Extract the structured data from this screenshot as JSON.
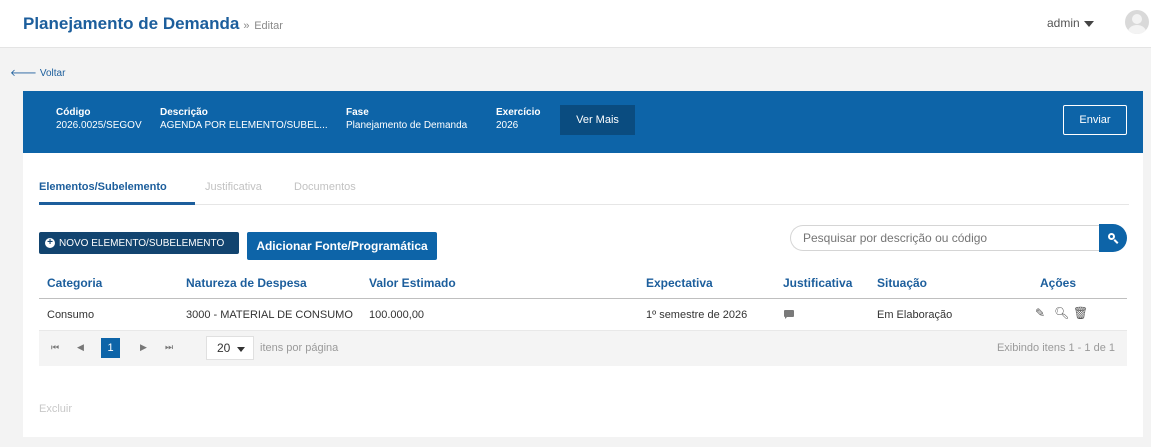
{
  "header": {
    "title": "Planejamento de Demanda",
    "separator": "»",
    "subtitle": "Editar",
    "user": "admin"
  },
  "back_label": "Voltar",
  "info": {
    "codigo_label": "Código",
    "codigo_value": "2026.0025/SEGOV",
    "descricao_label": "Descrição",
    "descricao_value": "AGENDA POR ELEMENTO/SUBEL...",
    "fase_label": "Fase",
    "fase_value": "Planejamento de Demanda",
    "exercicio_label": "Exercício",
    "exercicio_value": "2026",
    "ver_mais": "Ver Mais",
    "enviar": "Enviar"
  },
  "tabs": [
    {
      "label": "Elementos/Subelemento",
      "active": true
    },
    {
      "label": "Justificativa",
      "active": false
    },
    {
      "label": "Documentos",
      "active": false
    }
  ],
  "actions": {
    "novo_label": "NOVO ELEMENTO/SUBELEMENTO",
    "fonte_label": "Adicionar Fonte/Programática",
    "search_placeholder": "Pesquisar por descrição ou código"
  },
  "table": {
    "columns": [
      "Categoria",
      "Natureza de Despesa",
      "Valor Estimado",
      "Expectativa",
      "Justificativa",
      "Situação",
      "Ações"
    ],
    "rows": [
      {
        "categoria": "Consumo",
        "natureza": "3000 - MATERIAL DE CONSUMO",
        "valor": "100.000,00",
        "expectativa": "1º semestre de 2026",
        "situacao": "Em Elaboração"
      }
    ]
  },
  "pager": {
    "current_page": "1",
    "page_size": "20",
    "per_page_label": "itens por página",
    "info": "Exibindo itens 1 - 1 de 1"
  },
  "excluir_label": "Excluir",
  "colors": {
    "brand": "#1c5e9c",
    "band": "#0d64a8",
    "dark_button": "#12446f"
  }
}
